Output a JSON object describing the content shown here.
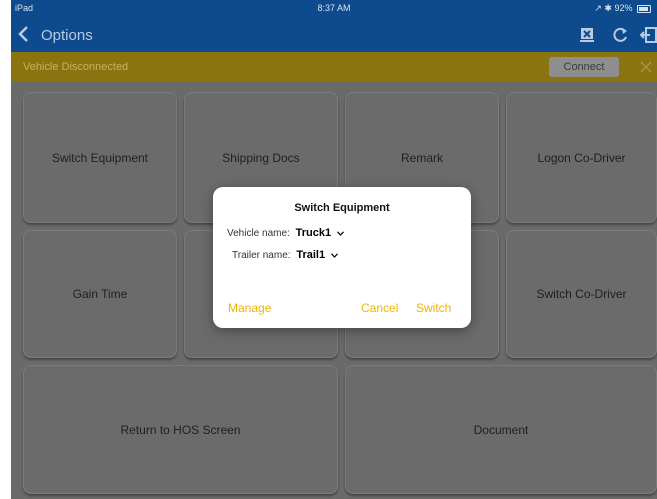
{
  "status_bar": {
    "device": "iPad",
    "time": "8:37 AM",
    "indicators": "↗ ✱ 92%"
  },
  "nav": {
    "title": "Options",
    "icons": [
      "back-chevron-icon",
      "device-x-icon",
      "refresh-icon",
      "exit-icon"
    ]
  },
  "banner": {
    "message": "Vehicle Disconnected",
    "connect_label": "Connect"
  },
  "tiles": [
    {
      "label": "Switch Equipment"
    },
    {
      "label": "Shipping Docs"
    },
    {
      "label": "Remark"
    },
    {
      "label": "Logon Co-Driver"
    },
    {
      "label": "Gain Time"
    },
    {
      "label": ""
    },
    {
      "label": ""
    },
    {
      "label": "Switch Co-Driver"
    },
    {
      "label": "Return to HOS Screen"
    },
    {
      "label": "Document"
    }
  ],
  "dialog": {
    "title": "Switch Equipment",
    "vehicle_label": "Vehicle name:",
    "vehicle_value": "Truck1",
    "trailer_label": "Trailer name:",
    "trailer_value": "Trail1",
    "manage_label": "Manage",
    "cancel_label": "Cancel",
    "switch_label": "Switch"
  },
  "colors": {
    "header": "#0d4b8e",
    "banner": "#8a7410",
    "accent": "#f0b400"
  }
}
